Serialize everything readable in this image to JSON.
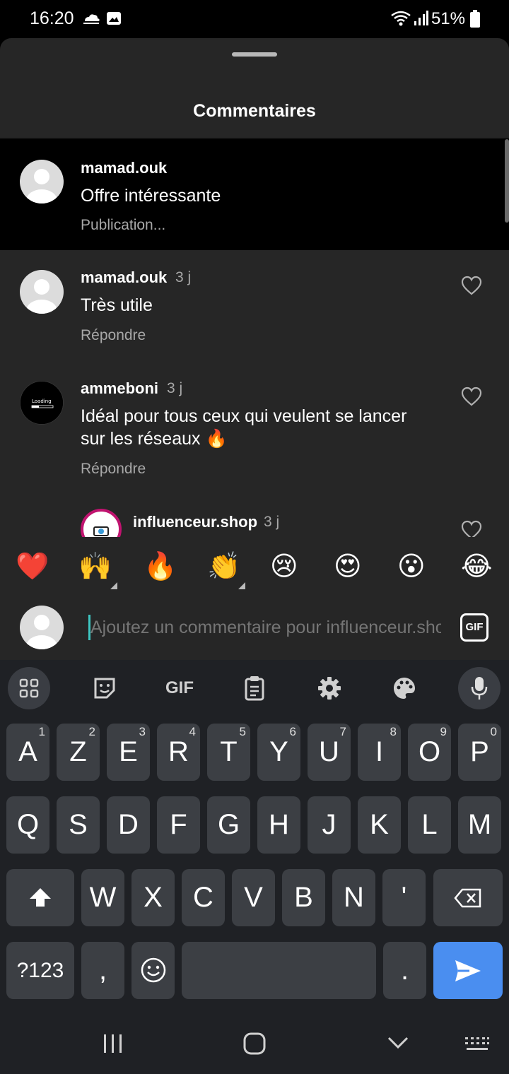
{
  "status_bar": {
    "time": "16:20",
    "battery_percent": "51%",
    "icons": [
      "weather-icon",
      "gallery-icon",
      "wifi-icon",
      "signal-icon",
      "battery-icon"
    ]
  },
  "sheet": {
    "title": "Commentaires"
  },
  "comments": [
    {
      "username": "mamad.ouk",
      "time_ago": "",
      "text": "Offre intéressante",
      "meta": "Publication...",
      "pending": true
    },
    {
      "username": "mamad.ouk",
      "time_ago": "3 j",
      "text": "Très utile",
      "meta": "Répondre"
    },
    {
      "username": "ammeboni",
      "time_ago": "3 j",
      "text_line1": "Idéal pour tous ceux qui veulent se lancer",
      "text_line2": "sur les réseaux 🔥",
      "meta": "Répondre",
      "avatar_label": "Loading"
    },
    {
      "username": "influenceur.shop",
      "time_ago": "3 j"
    }
  ],
  "emoji_bar": [
    "❤️",
    "🙌",
    "🔥",
    "👏",
    "😢",
    "😍",
    "😮",
    "😂"
  ],
  "composer": {
    "placeholder": "Ajoutez un commentaire pour influenceur.shop",
    "gif_label": "GIF"
  },
  "keyboard": {
    "toolbar": [
      "grid-icon",
      "sticker-icon",
      "GIF",
      "clipboard-icon",
      "settings-icon",
      "palette-icon",
      "mic-icon"
    ],
    "row1": [
      {
        "key": "A",
        "num": "1"
      },
      {
        "key": "Z",
        "num": "2"
      },
      {
        "key": "E",
        "num": "3"
      },
      {
        "key": "R",
        "num": "4"
      },
      {
        "key": "T",
        "num": "5"
      },
      {
        "key": "Y",
        "num": "6"
      },
      {
        "key": "U",
        "num": "7"
      },
      {
        "key": "I",
        "num": "8"
      },
      {
        "key": "O",
        "num": "9"
      },
      {
        "key": "P",
        "num": "0"
      }
    ],
    "row2": [
      "Q",
      "S",
      "D",
      "F",
      "G",
      "H",
      "J",
      "K",
      "L",
      "M"
    ],
    "row3": [
      "W",
      "X",
      "C",
      "V",
      "B",
      "N",
      "'"
    ],
    "symbols_label": "?123",
    "comma": ",",
    "period": "."
  },
  "colors": {
    "sheet_bg": "#262626",
    "keyboard_bg": "#1f2125",
    "key_bg": "#3c3f44",
    "send_key": "#4a8ef0",
    "cursor": "#3ec6c2"
  }
}
